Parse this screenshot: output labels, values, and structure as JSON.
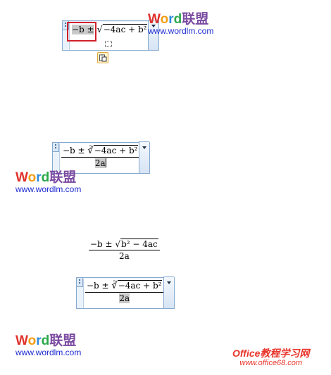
{
  "eq1": {
    "minus_b_pm": "−b ±",
    "radical_content": "−4ac + b²",
    "small_box_icon": "placeholder-box-icon",
    "paste_icon": "clipboard-paste-icon"
  },
  "eq2": {
    "numerator": "−b ± ",
    "root_index": "2",
    "radical_content": "−4ac + b²",
    "denominator": "2a"
  },
  "eq3": {
    "numerator_prefix": "−b ± √",
    "radical_content": "b² − 4ac",
    "denominator": "2a"
  },
  "eq4": {
    "numerator": "−b ± ",
    "root_index": "2",
    "radical_content": "−4ac + b²",
    "denominator": "2a"
  },
  "watermark": {
    "logo_letters": [
      "W",
      "o",
      "r",
      "d"
    ],
    "logo_cn": "联盟",
    "url": "www.wordlm.com"
  },
  "office_watermark": {
    "logo": "Office教程学习网",
    "url": "www.office68.com"
  },
  "colors": {
    "eq_border": "#86a9cf",
    "highlight_box": "#d2202a",
    "selection": "#c9c9c9"
  }
}
